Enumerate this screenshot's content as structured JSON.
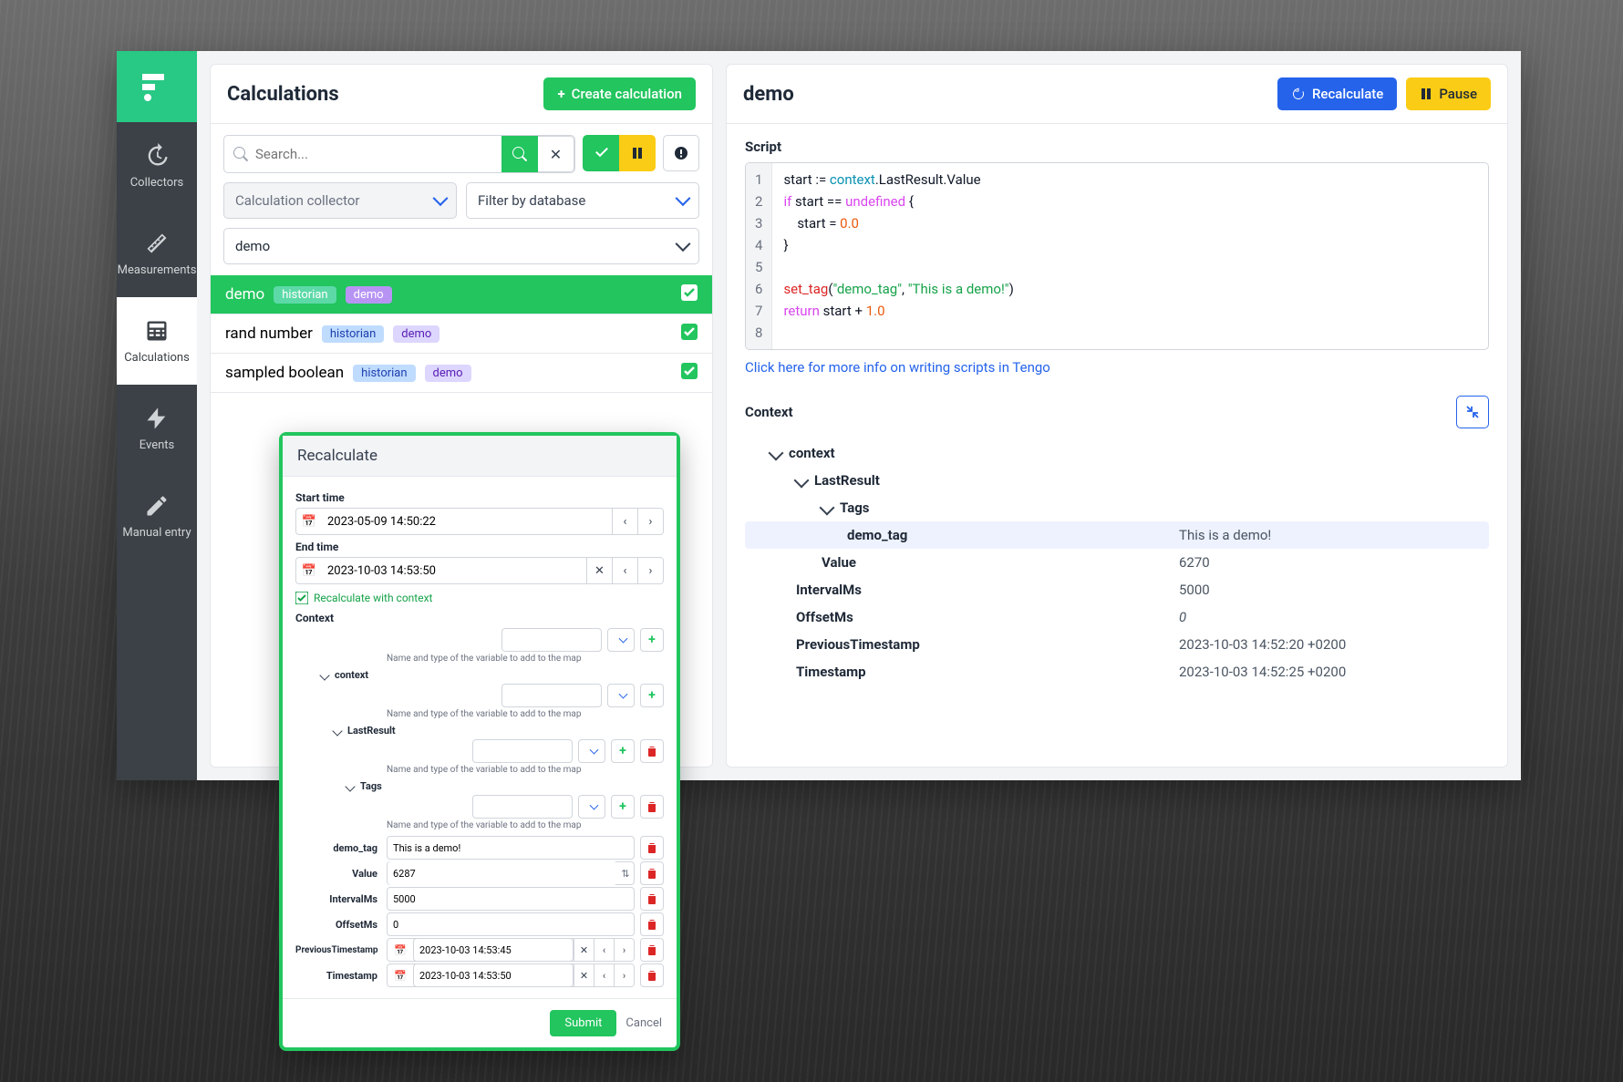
{
  "sidebar": {
    "items": [
      {
        "label": "Collectors"
      },
      {
        "label": "Measurements"
      },
      {
        "label": "Calculations"
      },
      {
        "label": "Events"
      },
      {
        "label": "Manual entry"
      }
    ]
  },
  "leftPanel": {
    "title": "Calculations",
    "createBtn": "Create calculation",
    "searchPlaceholder": "Search...",
    "collectorFilter": "Calculation collector",
    "dbFilter": "Filter by database",
    "selectedName": "demo",
    "items": [
      {
        "name": "demo",
        "tags": [
          "historian",
          "demo"
        ],
        "selected": true
      },
      {
        "name": "rand number",
        "tags": [
          "historian",
          "demo"
        ],
        "selected": false
      },
      {
        "name": "sampled boolean",
        "tags": [
          "historian",
          "demo"
        ],
        "selected": false
      }
    ]
  },
  "rightPanel": {
    "title": "demo",
    "recalcBtn": "Recalculate",
    "pauseBtn": "Pause",
    "scriptLabel": "Script",
    "linkText": "Click here for more info on writing scripts in Tengo",
    "contextLabel": "Context",
    "script": {
      "lines": [
        "1",
        "2",
        "3",
        "4",
        "5",
        "6",
        "7",
        "8"
      ]
    },
    "tree": {
      "root": "context",
      "lastResult": "LastResult",
      "tags": "Tags",
      "demoTagKey": "demo_tag",
      "demoTagVal": "This is a demo!",
      "valueKey": "Value",
      "valueVal": "6270",
      "intervalKey": "IntervalMs",
      "intervalVal": "5000",
      "offsetKey": "OffsetMs",
      "offsetVal": "0",
      "prevTsKey": "PreviousTimestamp",
      "prevTsVal": "2023-10-03 14:52:20 +0200",
      "tsKey": "Timestamp",
      "tsVal": "2023-10-03 14:52:25 +0200"
    }
  },
  "modal": {
    "title": "Recalculate",
    "startLabel": "Start time",
    "startVal": "2023-05-09 14:50:22",
    "endLabel": "End time",
    "endVal": "2023-10-03 14:53:50",
    "withCtx": "Recalculate with context",
    "contextLabel": "Context",
    "hint": "Name and type of the variable to add to the map",
    "nodes": {
      "context": "context",
      "lastResult": "LastResult",
      "tags": "Tags",
      "demoTag": "demo_tag",
      "demoTagVal": "This is a demo!",
      "value": "Value",
      "valueVal": "6287",
      "interval": "IntervalMs",
      "intervalVal": "5000",
      "offset": "OffsetMs",
      "offsetVal": "0",
      "prevTs": "PreviousTimestamp",
      "prevTsVal": "2023-10-03 14:53:45",
      "ts": "Timestamp",
      "tsVal": "2023-10-03 14:53:50"
    },
    "submit": "Submit",
    "cancel": "Cancel"
  }
}
